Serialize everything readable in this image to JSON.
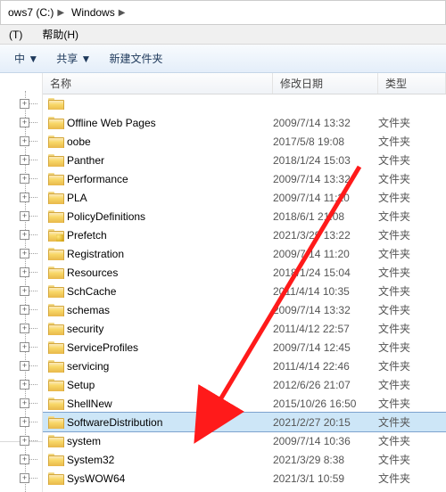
{
  "breadcrumb": {
    "seg1": "ows7 (C:)",
    "seg2": "Windows"
  },
  "menubar": {
    "item1": "(T)",
    "item2": "帮助(H)"
  },
  "toolbar": {
    "btn1": "中 ▼",
    "btn2": "共享 ▼",
    "btn3": "新建文件夹"
  },
  "columns": {
    "name": "名称",
    "date": "修改日期",
    "type": "类型"
  },
  "rows": [
    {
      "name": "",
      "date": "",
      "type": ""
    },
    {
      "name": "Offline Web Pages",
      "date": "2009/7/14 13:32",
      "type": "文件夹"
    },
    {
      "name": "oobe",
      "date": "2017/5/8 19:08",
      "type": "文件夹"
    },
    {
      "name": "Panther",
      "date": "2018/1/24 15:03",
      "type": "文件夹"
    },
    {
      "name": "Performance",
      "date": "2009/7/14 13:32",
      "type": "文件夹"
    },
    {
      "name": "PLA",
      "date": "2009/7/14 11:20",
      "type": "文件夹"
    },
    {
      "name": "PolicyDefinitions",
      "date": "2018/6/1 21:08",
      "type": "文件夹"
    },
    {
      "name": "Prefetch",
      "date": "2021/3/29 13:22",
      "type": "文件夹",
      "locked": true
    },
    {
      "name": "Registration",
      "date": "2009/7/14 11:20",
      "type": "文件夹"
    },
    {
      "name": "Resources",
      "date": "2018/1/24 15:04",
      "type": "文件夹"
    },
    {
      "name": "SchCache",
      "date": "2011/4/14 10:35",
      "type": "文件夹"
    },
    {
      "name": "schemas",
      "date": "2009/7/14 13:32",
      "type": "文件夹"
    },
    {
      "name": "security",
      "date": "2011/4/12 22:57",
      "type": "文件夹"
    },
    {
      "name": "ServiceProfiles",
      "date": "2009/7/14 12:45",
      "type": "文件夹"
    },
    {
      "name": "servicing",
      "date": "2011/4/14 22:46",
      "type": "文件夹"
    },
    {
      "name": "Setup",
      "date": "2012/6/26 21:07",
      "type": "文件夹"
    },
    {
      "name": "ShellNew",
      "date": "2015/10/26 16:50",
      "type": "文件夹"
    },
    {
      "name": "SoftwareDistribution",
      "date": "2021/2/27 20:15",
      "type": "文件夹",
      "selected": true
    },
    {
      "name": "system",
      "date": "2009/7/14 10:36",
      "type": "文件夹"
    },
    {
      "name": "System32",
      "date": "2021/3/29 8:38",
      "type": "文件夹"
    },
    {
      "name": "SysWOW64",
      "date": "2021/3/1 10:59",
      "type": "文件夹"
    }
  ]
}
